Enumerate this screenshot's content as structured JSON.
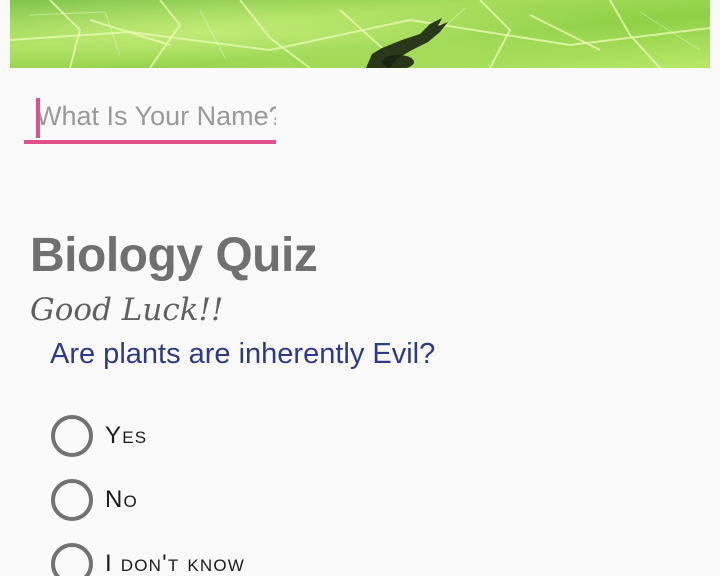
{
  "header_image": {
    "icon": "leaf-banner-image"
  },
  "name_input": {
    "placeholder": "What Is Your Name?",
    "value": "",
    "accent_color": "#e0508a"
  },
  "quiz": {
    "title": "Biology Quiz",
    "subtitle": "Good Luck!!",
    "question": "Are plants are inherently Evil?",
    "options": [
      {
        "label": "Yes",
        "selected": false
      },
      {
        "label": "No",
        "selected": false
      },
      {
        "label": "I don't know",
        "selected": false
      }
    ]
  },
  "colors": {
    "title": "#707070",
    "question": "#2e3a87",
    "radio_outline": "#727272",
    "background": "#fafafa"
  }
}
